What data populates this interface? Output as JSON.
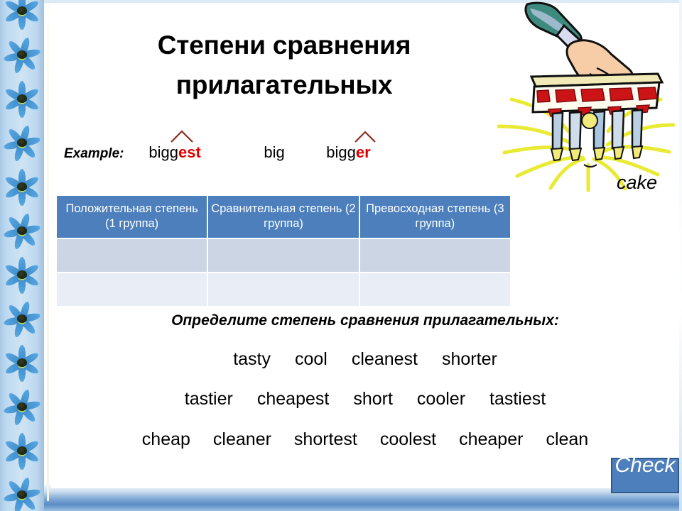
{
  "slide": {
    "title": "Степени сравнения прилагательных",
    "title_line1": "Степени сравнения",
    "title_line2": "прилагательных"
  },
  "example": {
    "label": "Example:",
    "words": [
      {
        "stem": "bigg",
        "suffix": "est",
        "has_caret": true
      },
      {
        "stem": "big",
        "suffix": "",
        "has_caret": false
      },
      {
        "stem": "bigg",
        "suffix": "er",
        "has_caret": true
      }
    ],
    "suffix_color": "#e00000",
    "caret_color": "#8b2b1e"
  },
  "table": {
    "headers": [
      "Положительная степень (1 группа)",
      "Сравнительная степень (2 группа)",
      "Превосходная степень (3 группа)"
    ],
    "header_bg": "#4d7fbd",
    "rows": [
      {
        "cells": [
          "",
          "",
          ""
        ],
        "bg": "#ccd5e4"
      },
      {
        "cells": [
          "",
          "",
          ""
        ],
        "bg": "#e9edf5"
      }
    ]
  },
  "task": {
    "prompt": "Определите степень сравнения прилагательных:",
    "word_rows": [
      [
        "tasty",
        "cool",
        "cleanest",
        "shorter"
      ],
      [
        "tastier",
        "cheapest",
        "short",
        "cooler",
        "tastiest"
      ],
      [
        "cheap",
        "cleaner",
        "shortest",
        "coolest",
        "cheaper",
        "clean"
      ]
    ]
  },
  "clipart": {
    "name": "cake-illustration",
    "caption": "cake"
  },
  "check_button": {
    "label": "Check",
    "bg": "#4d7fbd",
    "text_color": "#ffffff"
  },
  "decoration": {
    "flower_strip": "blue-flower-border",
    "flower_count": 12
  }
}
